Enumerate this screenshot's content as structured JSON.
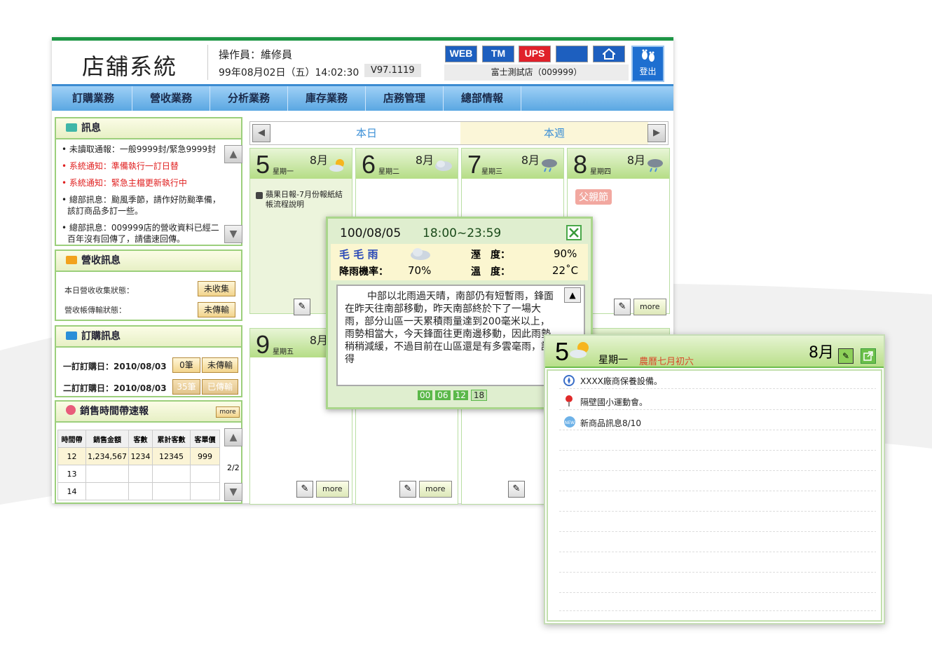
{
  "header": {
    "title": "店舖系統",
    "operator": "操作員：維修員",
    "datetime": "99年08月02日（五）14:02:30",
    "version": "V97.1119",
    "buttons": [
      "WEB",
      "TM",
      "UPS"
    ],
    "store": "富士測試店（009999）",
    "logout": "登出"
  },
  "nav": [
    "訂購業務",
    "營收業務",
    "分析業務",
    "庫存業務",
    "店務管理",
    "總部情報"
  ],
  "messages": {
    "title": "訊息",
    "items": [
      "未讀取通報：一般9999封/緊急9999封",
      "系統通知：準備執行一訂日替",
      "系統通知：緊急主檔更新執行中",
      "總部訊息：颱風季節，請作好防颱準備，該訂商品多訂一些。",
      "總部訊息：009999店的營收資料已經二百年沒有回傳了，請儘速回傳。"
    ]
  },
  "revenue": {
    "title": "營收訊息",
    "row1_label": "本日營收收集狀態：",
    "row1_value": "未收集",
    "row2_label": "營收帳傳輸狀態：",
    "row2_value": "未傳輸"
  },
  "orders": {
    "title": "訂購訊息",
    "row1_label": "一訂訂購日：2010/08/03",
    "row1_count": "0筆",
    "row1_status": "未傳輸",
    "row2_label": "二訂訂購日：2010/08/03",
    "row2_count": "35筆",
    "row2_status": "已傳輸"
  },
  "sales": {
    "title": "銷售時間帶速報",
    "more": "more",
    "columns": [
      "時間帶",
      "銷售金額",
      "客數",
      "累計客數",
      "客單價"
    ],
    "rows": [
      [
        "12",
        "1,234,567",
        "1234",
        "12345",
        "999"
      ],
      [
        "13",
        "",
        "",
        "",
        ""
      ],
      [
        "14",
        "",
        "",
        "",
        ""
      ]
    ],
    "page": "2/2"
  },
  "calendar": {
    "tab_today": "本日",
    "tab_week": "本週",
    "days": [
      {
        "num": "5",
        "weekday": "星期一",
        "month": "8月",
        "note": "蘋果日報-7月份報紙結帳流程說明"
      },
      {
        "num": "6",
        "weekday": "星期二",
        "month": "8月"
      },
      {
        "num": "7",
        "weekday": "星期三",
        "month": "8月"
      },
      {
        "num": "8",
        "weekday": "星期四",
        "month": "8月",
        "badge": "父親節"
      },
      {
        "num": "9",
        "weekday": "星期五",
        "month": "8月"
      }
    ],
    "more": "more",
    "partial": "08"
  },
  "weather": {
    "date": "100/08/05",
    "time": "18:00~23:59",
    "condition": "毛 毛 雨",
    "humidity_label": "溼　度：",
    "humidity": "90%",
    "rain_label": "降雨機率：",
    "rain": "70%",
    "temp_label": "溫　度：",
    "temp": "22˚C",
    "text": "中部以北雨過天晴，南部仍有短暫雨，鋒面在昨天往南部移動，昨天南部終於下了一場大雨，部分山區一天累積雨量達到200毫米以上，雨勢相當大，今天鋒面往更南邊移動，因此雨勢稍稍減緩，不過目前在山區還是有多雲毫雨，記得",
    "hours": [
      "00",
      "06",
      "12",
      "18"
    ]
  },
  "detail": {
    "num": "5",
    "weekday": "星期一",
    "lunar": "農曆七月初六",
    "month": "8月",
    "items": [
      "XXXX廠商保養設備。",
      "隔壁國小運動會。",
      "新商品訊息8/10"
    ]
  }
}
